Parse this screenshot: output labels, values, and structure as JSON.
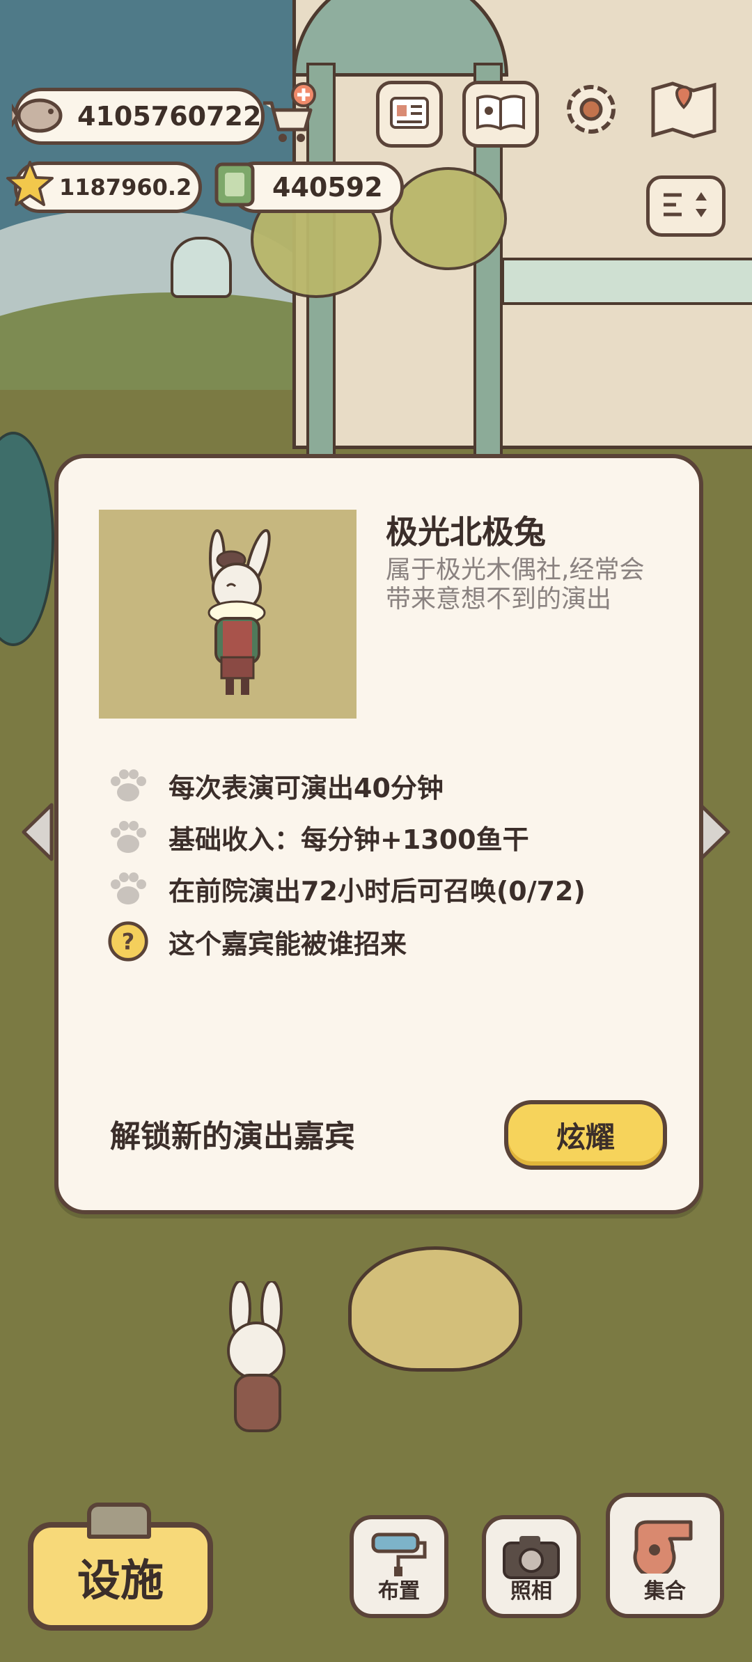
{
  "hud": {
    "fish_currency": "4105760722",
    "star_currency": "1187960.2",
    "ticket_currency": "440592"
  },
  "top_buttons": [
    {
      "icon": "id-card-icon"
    },
    {
      "icon": "paw-book-icon"
    },
    {
      "icon": "settings-gear-icon"
    },
    {
      "icon": "map-pin-icon"
    }
  ],
  "dialog": {
    "guest_name": "极光北极兔",
    "guest_description": "属于极光木偶社,经常会带来意想不到的演出",
    "info": [
      {
        "icon": "paw-icon",
        "text": "每次表演可演出40分钟"
      },
      {
        "icon": "paw-icon",
        "text": "基础收入：每分钟+1300鱼干"
      },
      {
        "icon": "paw-icon",
        "text": "在前院演出72小时后可召唤(0/72)"
      },
      {
        "icon": "question-icon",
        "text": "这个嘉宾能被谁招来"
      }
    ],
    "unlock_label": "解锁新的演出嘉宾",
    "show_button": "炫耀"
  },
  "bottom_bar": {
    "facility_button": "设施",
    "arrange_button": "布置",
    "photo_button": "照相",
    "gather_button": "集合"
  },
  "colors": {
    "accent_yellow": "#f6d35b",
    "outline_brown": "#5a4338",
    "dialog_bg": "#fbf5ec",
    "portrait_bg": "#c6b77f"
  }
}
